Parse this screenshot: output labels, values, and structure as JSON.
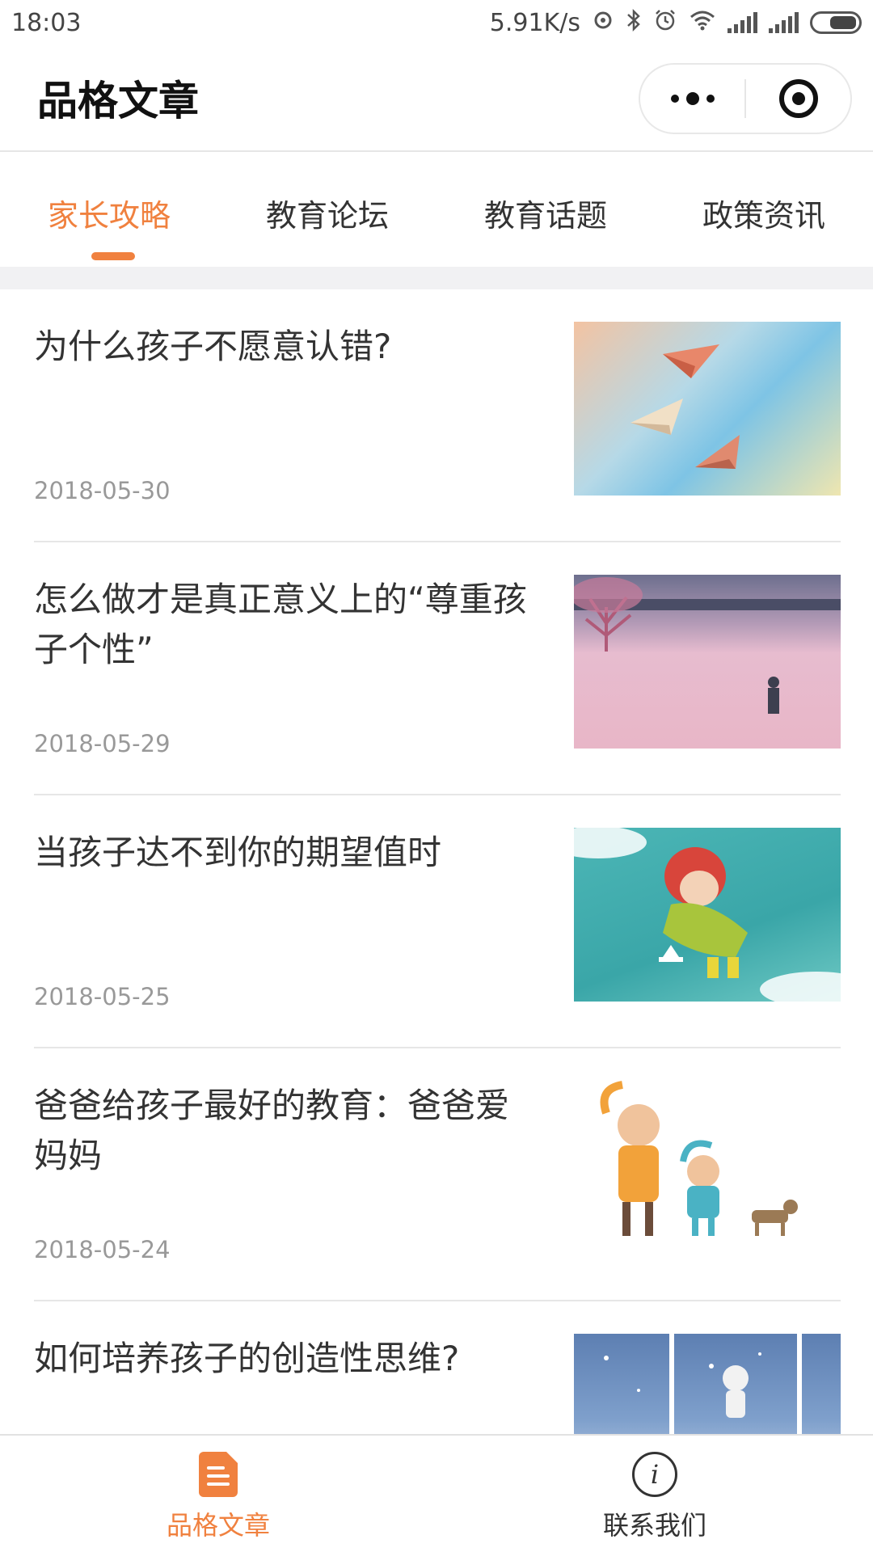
{
  "status_bar": {
    "time": "18:03",
    "net_speed": "5.91K/s"
  },
  "header": {
    "title": "品格文章"
  },
  "tabs": [
    {
      "label": "家长攻略",
      "active": true
    },
    {
      "label": "教育论坛",
      "active": false
    },
    {
      "label": "教育话题",
      "active": false
    },
    {
      "label": "政策资讯",
      "active": false
    }
  ],
  "articles": [
    {
      "title": "为什么孩子不愿意认错?",
      "date": "2018-05-30"
    },
    {
      "title": "怎么做才是真正意义上的“尊重孩子个性”",
      "date": "2018-05-29"
    },
    {
      "title": "当孩子达不到你的期望值时",
      "date": "2018-05-25"
    },
    {
      "title": "爸爸给孩子最好的教育：爸爸爱妈妈",
      "date": "2018-05-24"
    },
    {
      "title": "如何培养孩子的创造性思维?",
      "date": ""
    }
  ],
  "bottom_nav": [
    {
      "label": "品格文章",
      "icon": "document-icon",
      "active": true
    },
    {
      "label": "联系我们",
      "icon": "info-icon",
      "active": false
    }
  ],
  "colors": {
    "accent": "#f0813f",
    "divider": "#e6e6e6",
    "date_text": "#999999"
  }
}
